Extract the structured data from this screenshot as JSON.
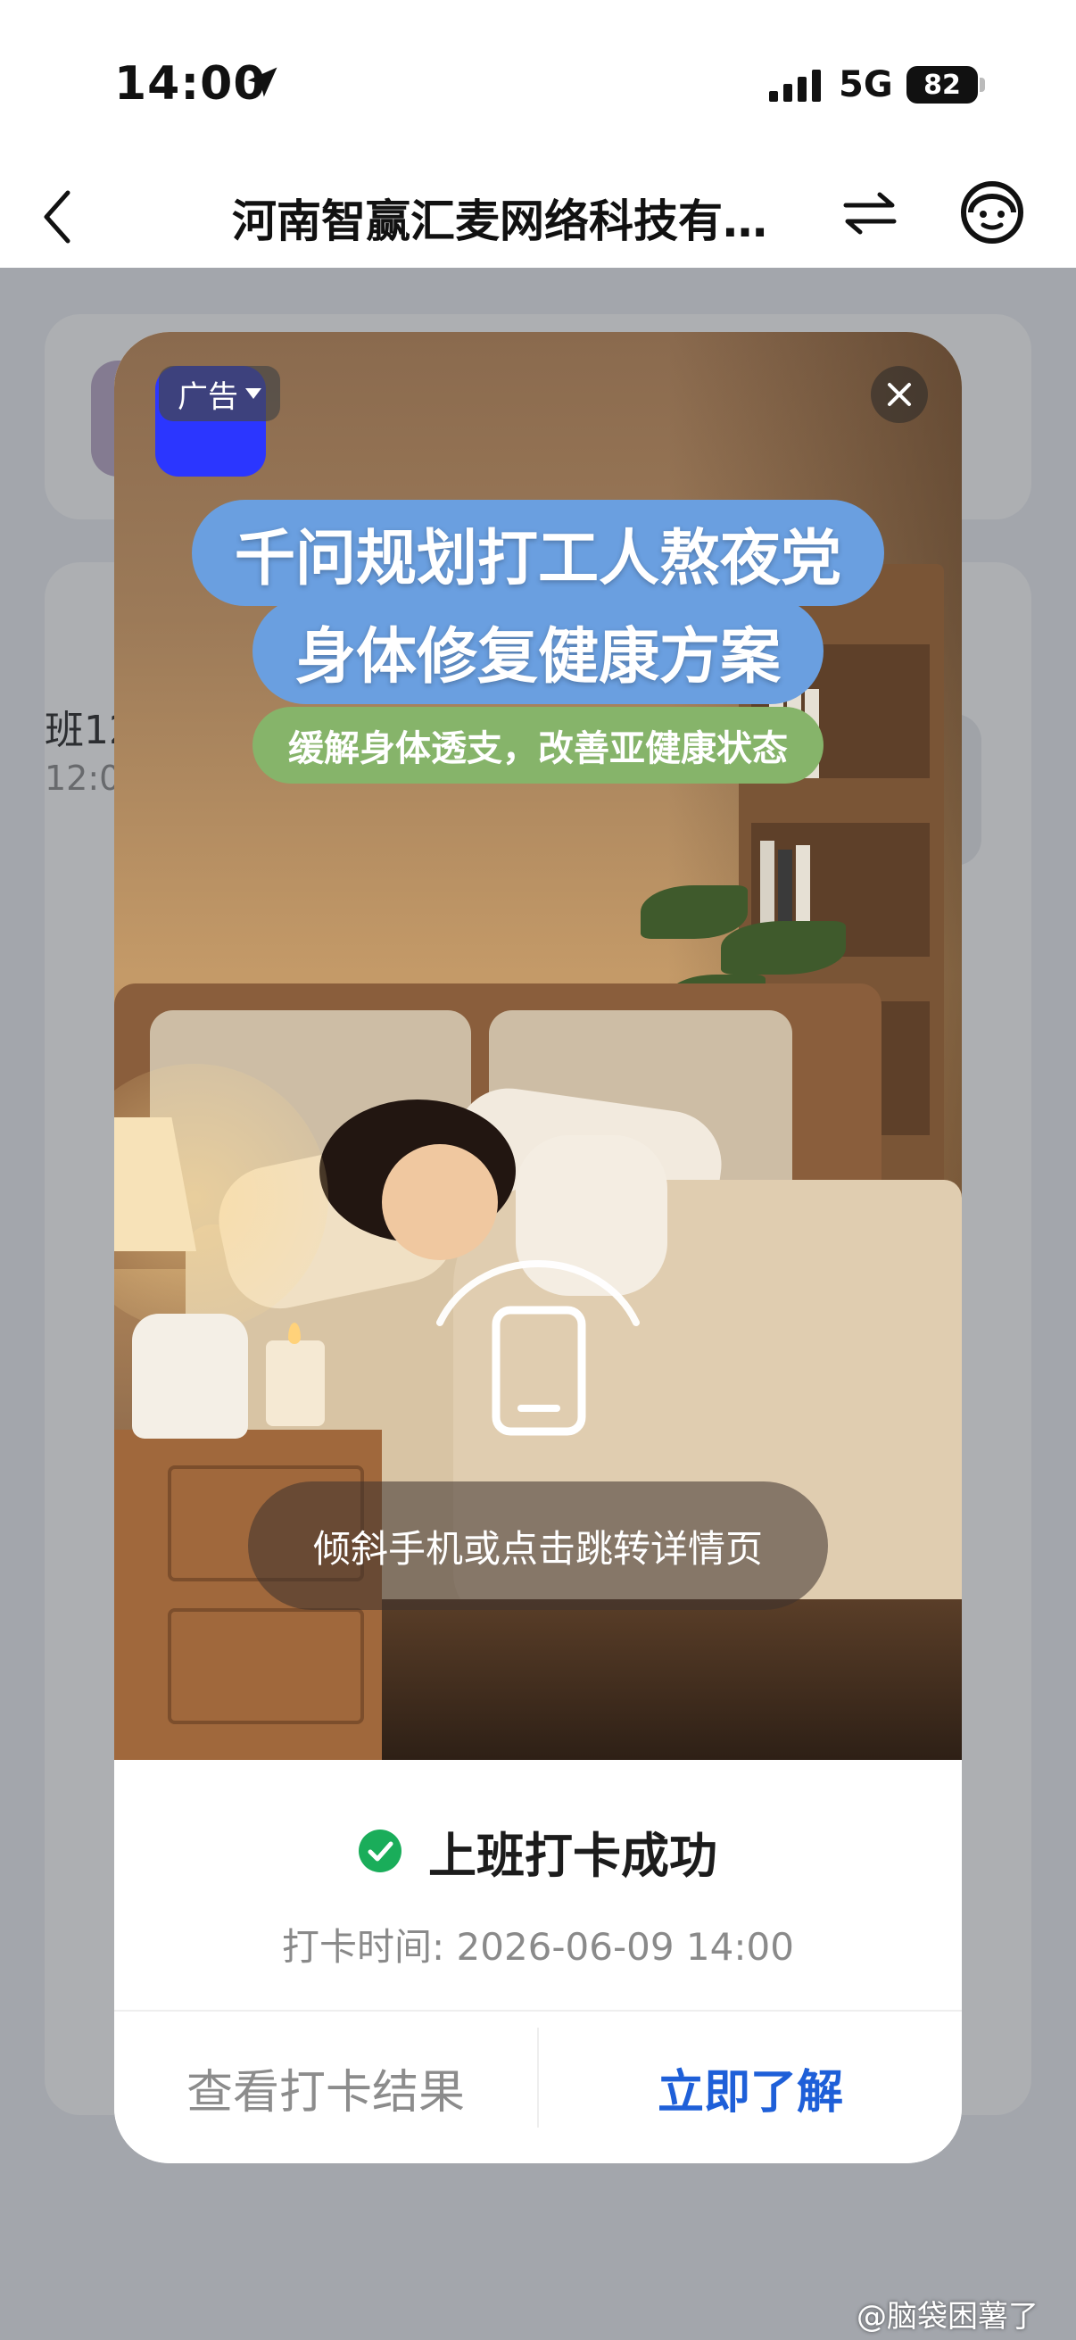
{
  "status_bar": {
    "time": "14:00",
    "network": "5G",
    "battery": "82"
  },
  "nav": {
    "title": "河南智赢汇麦网络科技有…"
  },
  "background": {
    "shift_label": "班12",
    "shift_time": "12:00"
  },
  "ad": {
    "badge": "广告",
    "headline_1": "千问规划打工人熬夜党",
    "headline_2": "身体修复健康方案",
    "sub": "缓解身体透支，改善亚健康状态",
    "tilt_hint": "倾斜手机或点击跳转详情页",
    "headline_color": "#6a9fe0",
    "sub_color": "#86b46a"
  },
  "checkin": {
    "status": "上班打卡成功",
    "time_label": "打卡时间: 2026-06-09 14:00",
    "view_result": "查看打卡结果",
    "learn_more": "立即了解",
    "success_color": "#1aad5a",
    "link_color": "#1e5fd8"
  },
  "watermark": "@脑袋困薯了"
}
